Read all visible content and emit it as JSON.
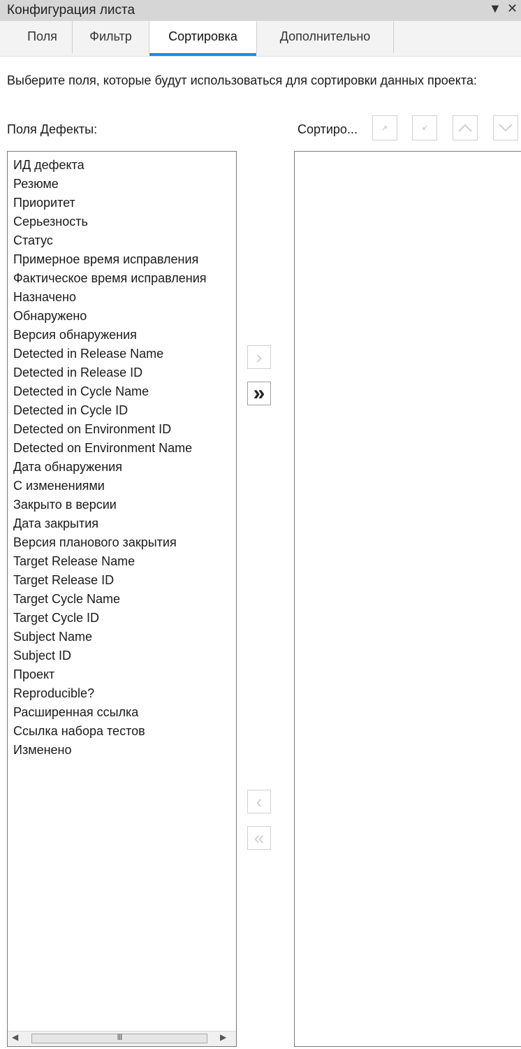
{
  "panel": {
    "title": "Конфигурация листа",
    "pin_glyph": "▼",
    "close_glyph": "✕"
  },
  "tabs": [
    {
      "label": "Поля"
    },
    {
      "label": "Фильтр"
    },
    {
      "label": "Сортировка",
      "active": true
    },
    {
      "label": "Дополнительно"
    }
  ],
  "description": "Выберите поля, которые будут использоваться для сортировки данных проекта:",
  "left_list": {
    "label": "Поля Дефекты:",
    "items": [
      "ИД дефекта",
      "Резюме",
      "Приоритет",
      "Серьезность",
      "Статус",
      "Примерное время исправления",
      "Фактическое время исправления",
      "Назначено",
      "Обнаружено",
      "Версия обнаружения",
      "Detected in Release Name",
      "Detected in Release ID",
      "Detected in Cycle Name",
      "Detected in Cycle ID",
      "Detected on Environment ID",
      "Detected on Environment Name",
      "Дата обнаружения",
      "С изменениями",
      "Закрыто в версии",
      "Дата закрытия",
      "Версия планового закрытия",
      "Target Release Name",
      "Target Release ID",
      "Target Cycle Name",
      "Target Cycle ID",
      "Subject Name",
      "Subject ID",
      "Проект",
      "Reproducible?",
      "Расширенная ссылка",
      "Ссылка набора тестов",
      "Изменено"
    ],
    "scroll_grip": "III",
    "scroll_left": "◀",
    "scroll_right": "▶"
  },
  "right_list": {
    "label": "Сортиро..."
  },
  "transfer_buttons": {
    "add_one": "›",
    "add_all": "»",
    "remove_one": "‹",
    "remove_all": "«"
  },
  "colors": {
    "accent": "#1e88e5",
    "titlebar": "#d6d6d6",
    "tabbar": "#f3f3f3"
  }
}
